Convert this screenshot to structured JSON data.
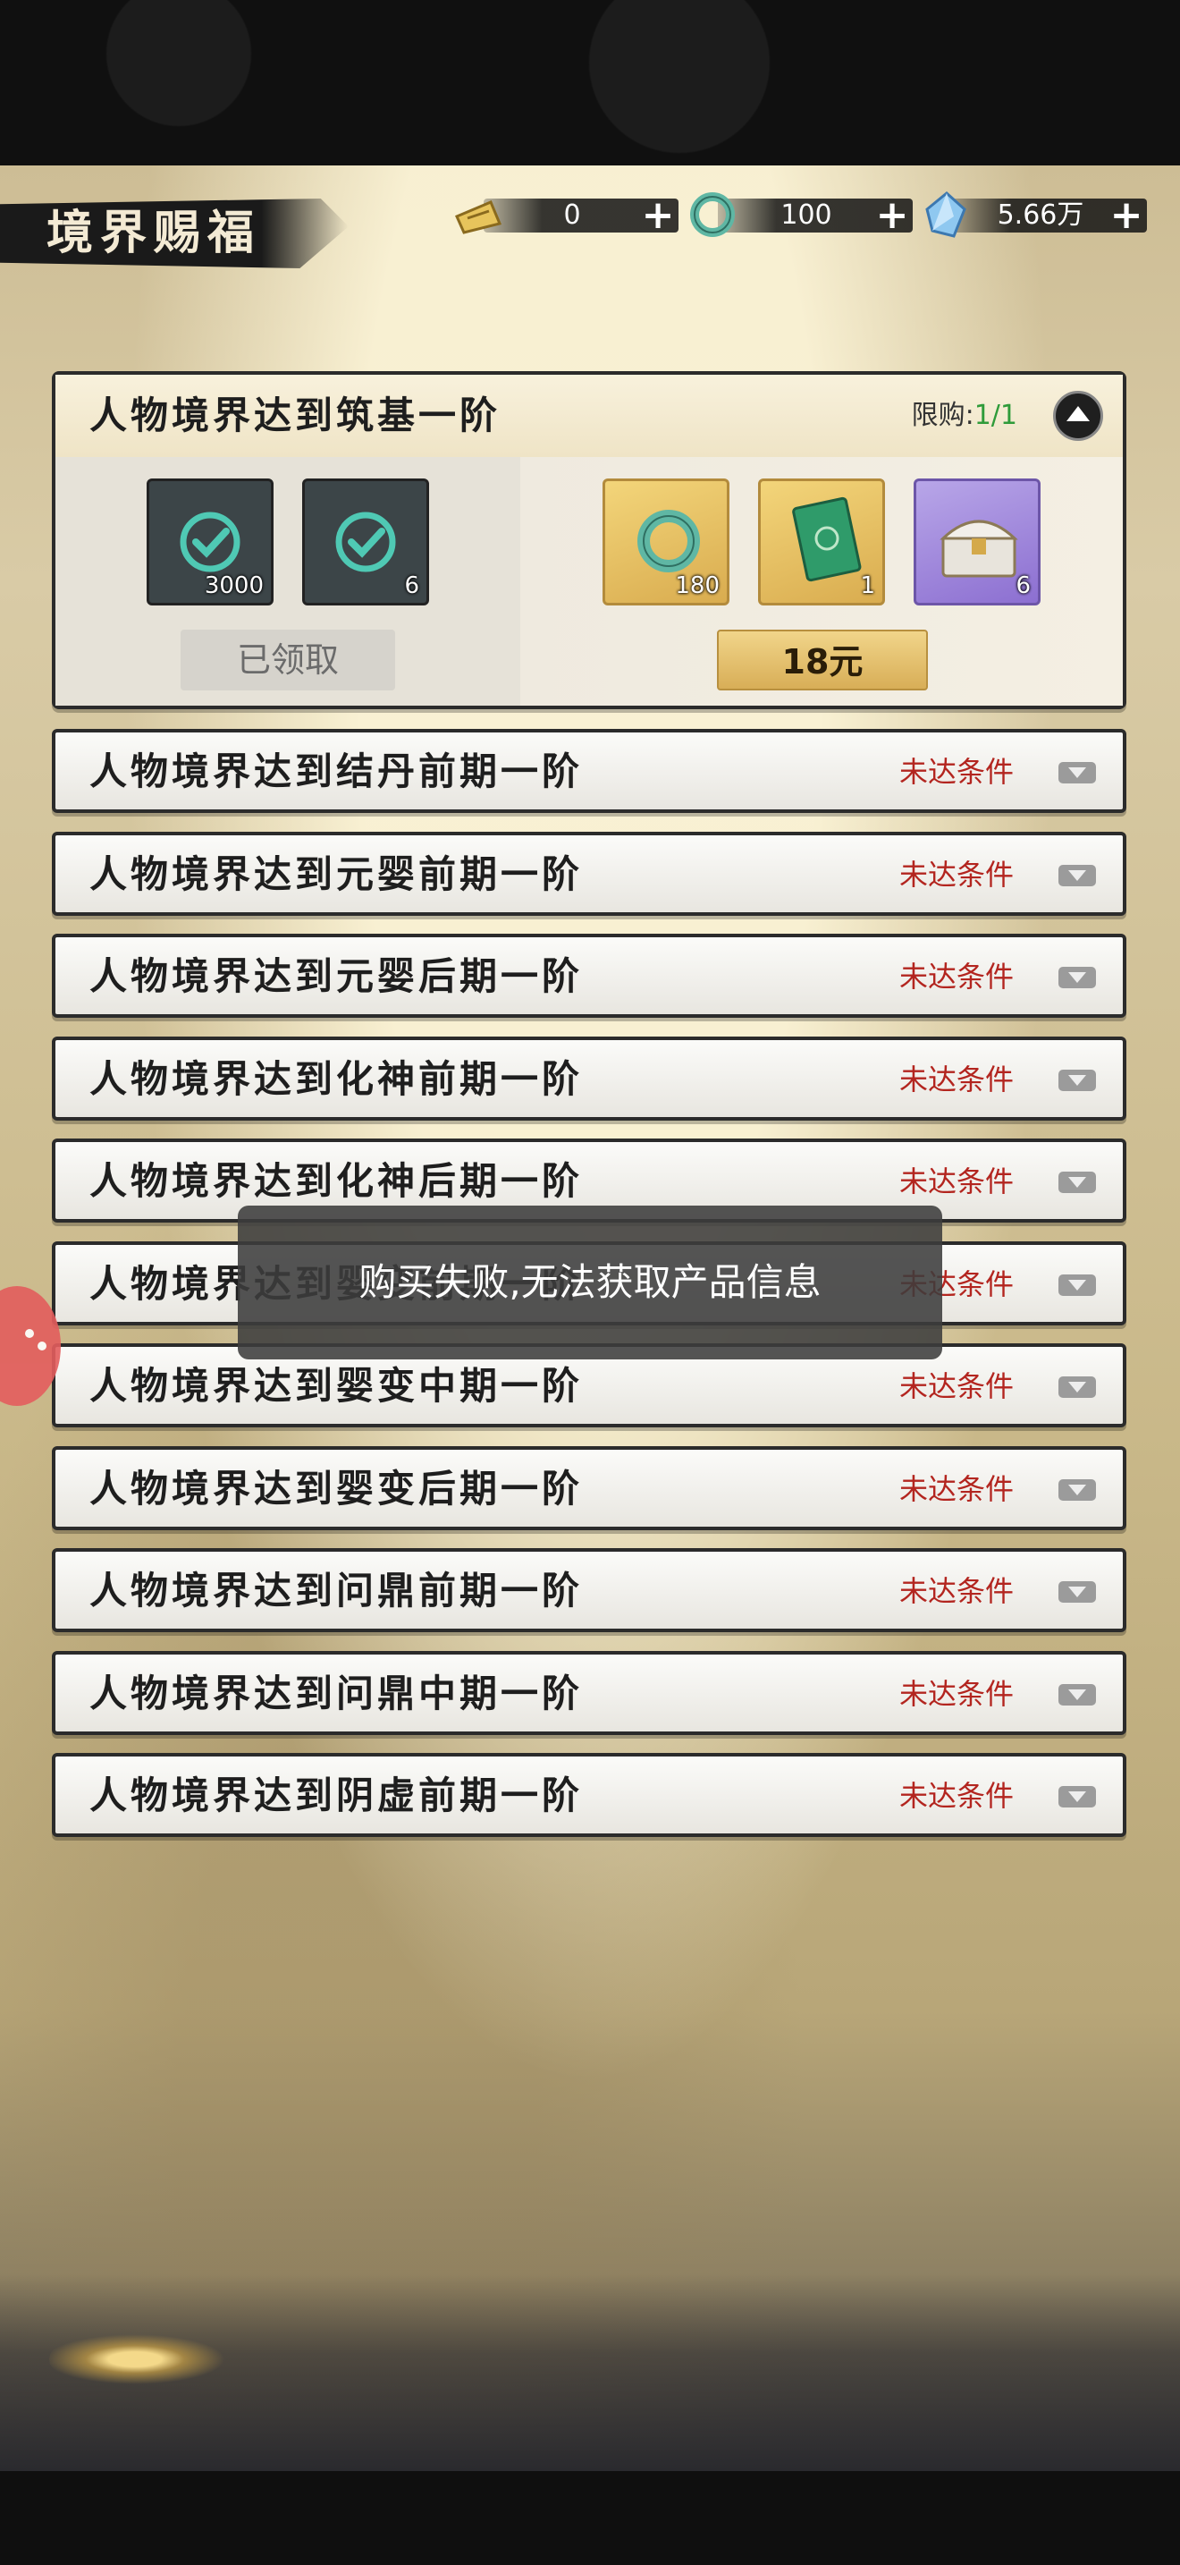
{
  "header": {
    "title": "境界赐福",
    "currencies": [
      {
        "icon": "ticket-icon",
        "value": "0"
      },
      {
        "icon": "jade-icon",
        "value": "100"
      },
      {
        "icon": "crystal-icon",
        "value": "5.66万"
      }
    ],
    "plus": "+"
  },
  "expanded": {
    "title": "人物境界达到筑基一阶",
    "limit_label": "限购:",
    "limit_value": "1/1",
    "free_rewards": [
      {
        "icon": "spirit-stone-icon",
        "qty": "3000"
      },
      {
        "icon": "herb-icon",
        "qty": "6"
      }
    ],
    "claimed_label": "已领取",
    "paid_rewards": [
      {
        "icon": "jade-icon",
        "qty": "180"
      },
      {
        "icon": "book-icon",
        "qty": "1"
      },
      {
        "icon": "treasure-chest-icon",
        "qty": "6"
      }
    ],
    "price_label": "18元"
  },
  "rows": [
    {
      "label": "人物境界达到结丹前期一阶",
      "status": "未达条件"
    },
    {
      "label": "人物境界达到元婴前期一阶",
      "status": "未达条件"
    },
    {
      "label": "人物境界达到元婴后期一阶",
      "status": "未达条件"
    },
    {
      "label": "人物境界达到化神前期一阶",
      "status": "未达条件"
    },
    {
      "label": "人物境界达到化神后期一阶",
      "status": "未达条件"
    },
    {
      "label": "人物境界达到婴变前期一阶",
      "status": "未达条件"
    },
    {
      "label": "人物境界达到婴变中期一阶",
      "status": "未达条件"
    },
    {
      "label": "人物境界达到婴变后期一阶",
      "status": "未达条件"
    },
    {
      "label": "人物境界达到问鼎前期一阶",
      "status": "未达条件"
    },
    {
      "label": "人物境界达到问鼎中期一阶",
      "status": "未达条件"
    },
    {
      "label": "人物境界达到阴虚前期一阶",
      "status": "未达条件"
    }
  ],
  "toast": "购买失败,无法获取产品信息"
}
